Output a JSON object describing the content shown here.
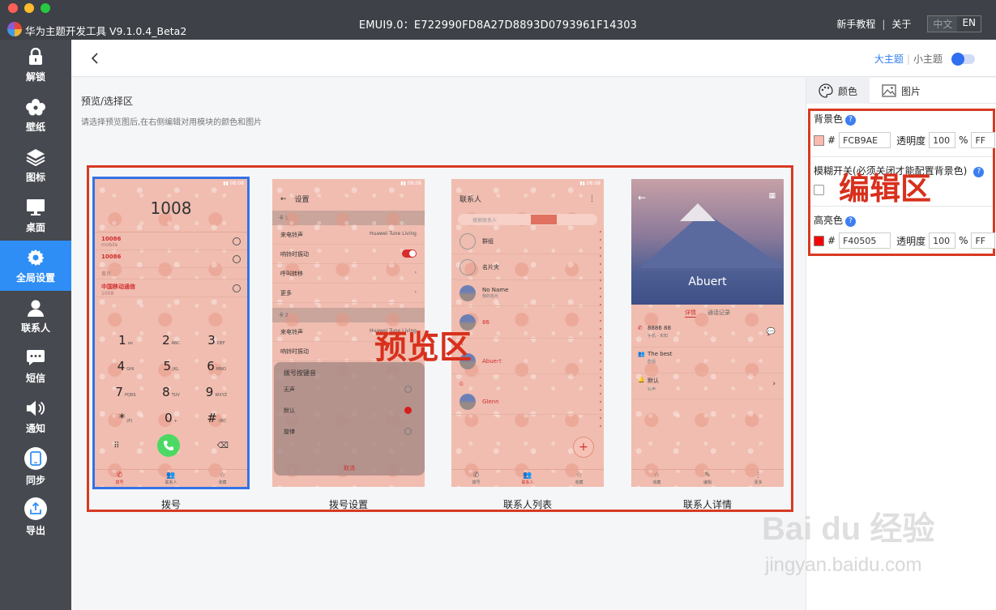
{
  "titlebar": {
    "app_name": "华为主题开发工具 V9.1.0.4_Beta2",
    "theme_id": "EMUI9.0：E722990FD8A27D8893D0793961F14303",
    "tutorial": "新手教程",
    "about": "关于",
    "lang_zh": "中文",
    "lang_en": "EN"
  },
  "sidebar": {
    "items": [
      {
        "label": "解锁",
        "icon": "lock-icon"
      },
      {
        "label": "壁纸",
        "icon": "flower-icon"
      },
      {
        "label": "图标",
        "icon": "layers-icon"
      },
      {
        "label": "桌面",
        "icon": "monitor-icon"
      },
      {
        "label": "全局设置",
        "icon": "gear-icon",
        "active": true
      },
      {
        "label": "联系人",
        "icon": "person-icon"
      },
      {
        "label": "短信",
        "icon": "message-icon"
      },
      {
        "label": "通知",
        "icon": "speaker-icon"
      },
      {
        "label": "同步",
        "icon": "phone-icon"
      },
      {
        "label": "导出",
        "icon": "export-icon"
      }
    ]
  },
  "topbar": {
    "big_theme": "大主题",
    "small_theme": "小主题"
  },
  "preview": {
    "title": "预览/选择区",
    "desc": "请选择预览图后,在右侧编辑对用模块的颜色和图片",
    "annotation": "预览区",
    "captions": [
      "拨号",
      "拨号设置",
      "联系人列表",
      "联系人详情"
    ]
  },
  "phone_dial": {
    "number": "1008",
    "calls": [
      {
        "num": "10086",
        "sub": "mobile"
      },
      {
        "num": "10086",
        "sub": ""
      },
      {
        "num": "中国移动通信",
        "sub": "1008"
      }
    ],
    "section": "黄页",
    "keys": [
      {
        "k": "1",
        "s": "oo"
      },
      {
        "k": "2",
        "s": "ABC"
      },
      {
        "k": "3",
        "s": "DEF"
      },
      {
        "k": "4",
        "s": "GHI"
      },
      {
        "k": "5",
        "s": "JKL"
      },
      {
        "k": "6",
        "s": "MNO"
      },
      {
        "k": "7",
        "s": "PQRS"
      },
      {
        "k": "8",
        "s": "TUV"
      },
      {
        "k": "9",
        "s": "WXYZ"
      },
      {
        "k": "*",
        "s": "(P)"
      },
      {
        "k": "0",
        "s": "+"
      },
      {
        "k": "#",
        "s": "(W)"
      }
    ],
    "tabs": [
      "拨号",
      "联系人",
      "收藏"
    ]
  },
  "phone_settings": {
    "title": "设置",
    "group1": "卡 1",
    "group2": "卡 2",
    "rows1": [
      {
        "label": "来电铃声",
        "value": "Huawei Tune Living"
      },
      {
        "label": "响铃时振动",
        "value": ""
      },
      {
        "label": "呼叫转移",
        "value": ""
      },
      {
        "label": "更多",
        "value": ""
      }
    ],
    "rows2": [
      {
        "label": "来电铃声",
        "value": "Huawei Tune Living"
      },
      {
        "label": "响铃时振动",
        "value": ""
      }
    ],
    "dialog_title": "拨号按键音",
    "dialog_options": [
      "无声",
      "默认",
      "旋律"
    ],
    "dialog_cancel": "取消"
  },
  "phone_contacts": {
    "title": "联系人",
    "search": "搜索联系人",
    "rows": [
      {
        "name": "群组",
        "sub": ""
      },
      {
        "name": "名片夹",
        "sub": ""
      },
      {
        "name": "No Name",
        "sub": "我的名片"
      }
    ],
    "letter_a": "A",
    "abuert": "Abuert",
    "letter_g": "G",
    "glenn": "Glenn",
    "partial": "86",
    "tabs": [
      "拨号",
      "联系人",
      "收藏"
    ]
  },
  "phone_detail": {
    "name": "Abuert",
    "tab_on": "详情",
    "tab_off": "通话记录",
    "rows": [
      {
        "title": "8886 88",
        "sub": "手机 - 未知"
      },
      {
        "title": "The best",
        "sub": "群组"
      },
      {
        "title": "默认",
        "sub": "铃声"
      }
    ],
    "tabs": [
      "收藏",
      "编辑",
      "更多"
    ]
  },
  "right_panel": {
    "tab_color": "颜色",
    "tab_image": "图片",
    "bg_color_label": "背景色",
    "bg_hex": "FCB9AE",
    "bg_swatch": "#fcb9ae",
    "opacity_label": "透明度",
    "bg_opacity": "100",
    "percent": "%",
    "bg_alpha": "FF",
    "blur_label": "模糊开关(必须关闭才能配置背景色)",
    "highlight_label": "高亮色",
    "hl_hex": "F40505",
    "hl_swatch": "#f40505",
    "hl_opacity": "100",
    "hl_alpha": "FF",
    "hash": "#",
    "annotation": "编辑区"
  },
  "watermark": {
    "text": "Bai du 经验",
    "url": "jingyan.baidu.com"
  }
}
